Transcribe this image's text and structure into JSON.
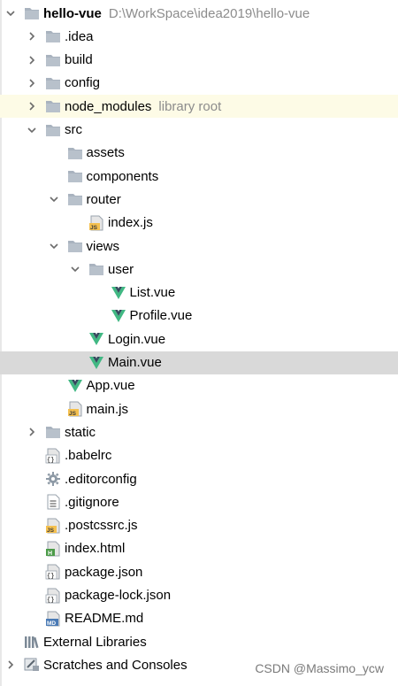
{
  "colors": {
    "folder": "#a9b3bf",
    "vue_green": "#41b883",
    "vue_dark": "#35495e",
    "js_yellow": "#f4c04f",
    "html_green": "#4c9b49",
    "md_blue": "#4a7ab5",
    "library_bg": "#fdfbe6",
    "selected_bg": "#d9d9d9"
  },
  "project": {
    "name": "hello-vue",
    "path": "D:\\WorkSpace\\idea2019\\hello-vue"
  },
  "items": [
    {
      "label": "hello-vue",
      "hint": "D:\\WorkSpace\\idea2019\\hello-vue",
      "icon": "folder-icon",
      "depth": 0,
      "arrow": "down",
      "state": "root"
    },
    {
      "label": ".idea",
      "icon": "folder-icon",
      "depth": 1,
      "arrow": "right"
    },
    {
      "label": "build",
      "icon": "folder-icon",
      "depth": 1,
      "arrow": "right"
    },
    {
      "label": "config",
      "icon": "folder-icon",
      "depth": 1,
      "arrow": "right"
    },
    {
      "label": "node_modules",
      "hint": "library root",
      "icon": "folder-icon",
      "depth": 1,
      "arrow": "right",
      "state": "library"
    },
    {
      "label": "src",
      "icon": "folder-icon",
      "depth": 1,
      "arrow": "down"
    },
    {
      "label": "assets",
      "icon": "folder-icon",
      "depth": 2,
      "arrow": "none"
    },
    {
      "label": "components",
      "icon": "folder-icon",
      "depth": 2,
      "arrow": "none"
    },
    {
      "label": "router",
      "icon": "folder-icon",
      "depth": 2,
      "arrow": "down"
    },
    {
      "label": "index.js",
      "icon": "js-file-icon",
      "depth": 3,
      "arrow": "none"
    },
    {
      "label": "views",
      "icon": "folder-icon",
      "depth": 2,
      "arrow": "down"
    },
    {
      "label": "user",
      "icon": "folder-icon",
      "depth": 3,
      "arrow": "down"
    },
    {
      "label": "List.vue",
      "icon": "vue-file-icon",
      "depth": 4,
      "arrow": "none"
    },
    {
      "label": "Profile.vue",
      "icon": "vue-file-icon",
      "depth": 4,
      "arrow": "none"
    },
    {
      "label": "Login.vue",
      "icon": "vue-file-icon",
      "depth": 3,
      "arrow": "none"
    },
    {
      "label": "Main.vue",
      "icon": "vue-file-icon",
      "depth": 3,
      "arrow": "none",
      "state": "selected"
    },
    {
      "label": "App.vue",
      "icon": "vue-file-icon",
      "depth": 2,
      "arrow": "none"
    },
    {
      "label": "main.js",
      "icon": "js-file-icon",
      "depth": 2,
      "arrow": "none"
    },
    {
      "label": "static",
      "icon": "folder-icon",
      "depth": 1,
      "arrow": "right"
    },
    {
      "label": ".babelrc",
      "icon": "json-file-icon",
      "depth": 1,
      "arrow": "none"
    },
    {
      "label": ".editorconfig",
      "icon": "gear-icon",
      "depth": 1,
      "arrow": "none"
    },
    {
      "label": ".gitignore",
      "icon": "text-file-icon",
      "depth": 1,
      "arrow": "none"
    },
    {
      "label": ".postcssrc.js",
      "icon": "js-file-icon",
      "depth": 1,
      "arrow": "none"
    },
    {
      "label": "index.html",
      "icon": "html-file-icon",
      "depth": 1,
      "arrow": "none"
    },
    {
      "label": "package.json",
      "icon": "json-file-icon",
      "depth": 1,
      "arrow": "none"
    },
    {
      "label": "package-lock.json",
      "icon": "json-file-icon",
      "depth": 1,
      "arrow": "none"
    },
    {
      "label": "README.md",
      "icon": "md-file-icon",
      "depth": 1,
      "arrow": "none"
    },
    {
      "label": "External Libraries",
      "icon": "libraries-icon",
      "depth": 0,
      "arrow": "none"
    },
    {
      "label": "Scratches and Consoles",
      "icon": "scratches-icon",
      "depth": 0,
      "arrow": "right"
    }
  ],
  "watermark": "CSDN @Massimo_ycw"
}
